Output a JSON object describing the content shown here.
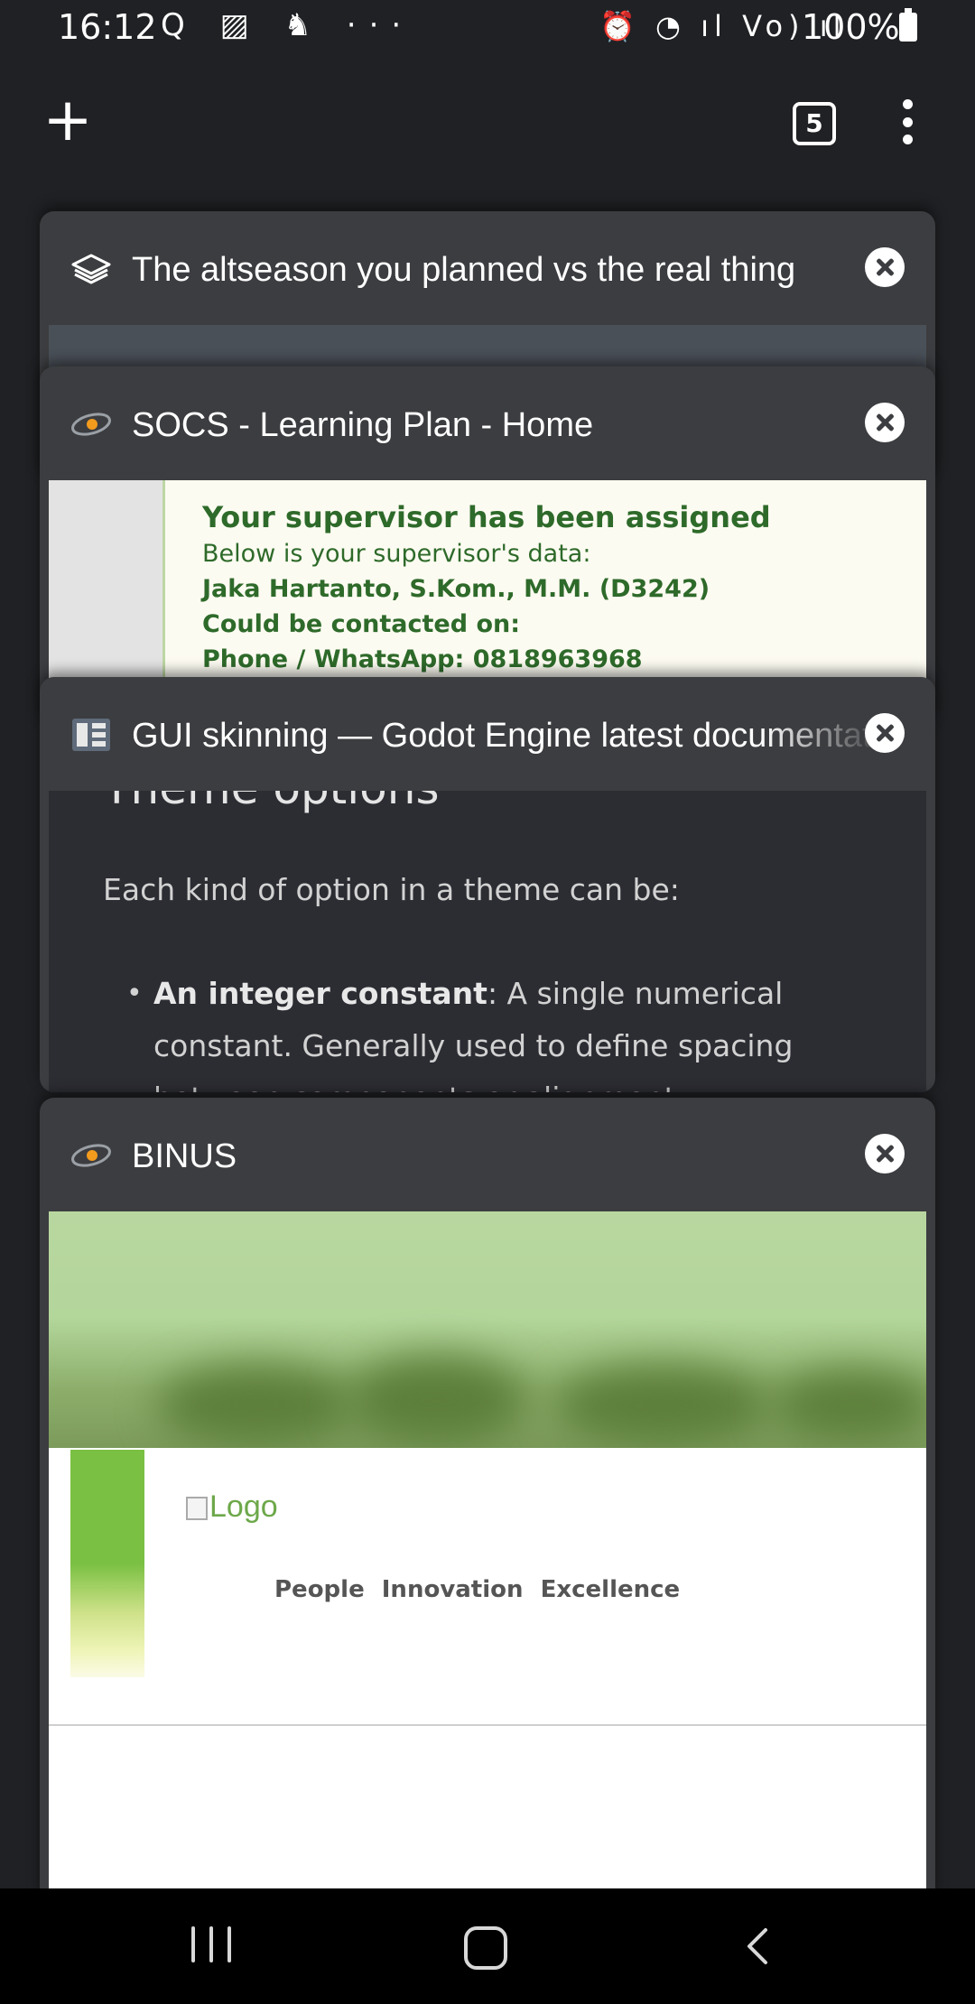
{
  "status_bar": {
    "time": "16:12",
    "left_icons": "Q ▨ ♞ ···",
    "right_icons": "⏰ ◔ ıl Vo) ıl",
    "battery": "100%"
  },
  "toolbar": {
    "new_tab_icon": "plus-icon",
    "tab_count": "5",
    "menu_icon": "overflow-menu-icon"
  },
  "tabs": [
    {
      "title": "The altseason you planned vs the real thing",
      "favicon": "stacked-layers-icon"
    },
    {
      "title": "SOCS - Learning Plan - Home",
      "favicon": "binus-swirl-icon",
      "preview": {
        "heading": "Your supervisor has been assigned",
        "line1": "Below is your supervisor's data:",
        "line2": "Jaka Hartanto, S.Kom., M.M. (D3242)",
        "line3": "Could be contacted on:",
        "line4": "Phone / WhatsApp: 0818963968"
      }
    },
    {
      "title": "GUI skinning — Godot Engine latest documentation",
      "favicon": "godot-docs-icon",
      "preview": {
        "heading": "Theme options",
        "para": "Each kind of option in a theme can be:",
        "bold": "An integer constant",
        "rest": ": A single numerical constant. Generally used to define spacing between components or alignment."
      }
    },
    {
      "title": "BINUS",
      "favicon": "binus-swirl-icon",
      "preview": {
        "logo_alt": "Logo",
        "tagline": "People Innovation Excellence"
      }
    }
  ],
  "nav_bar": {
    "recents_icon": "recents-icon",
    "home_icon": "home-icon",
    "back_icon": "back-icon"
  }
}
